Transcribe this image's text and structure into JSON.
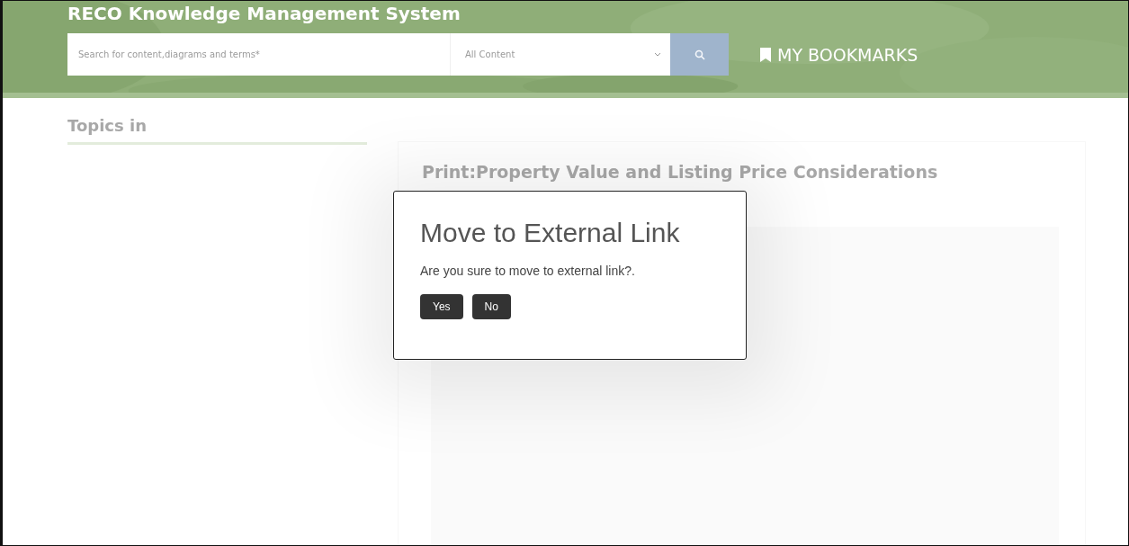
{
  "header": {
    "title": "RECO Knowledge Management System",
    "search": {
      "placeholder": "Search for content,diagrams and terms*"
    },
    "filter": {
      "value": "All Content"
    },
    "bookmarks": "MY BOOKMARKS"
  },
  "sidebar": {
    "title": "Topics in"
  },
  "article": {
    "title": "Print:Property Value and Listing Price Considerations"
  },
  "dialog": {
    "title": "Move to External Link",
    "message": "Are you sure to move to external link?.",
    "buttons": [
      "Yes",
      "No"
    ]
  }
}
